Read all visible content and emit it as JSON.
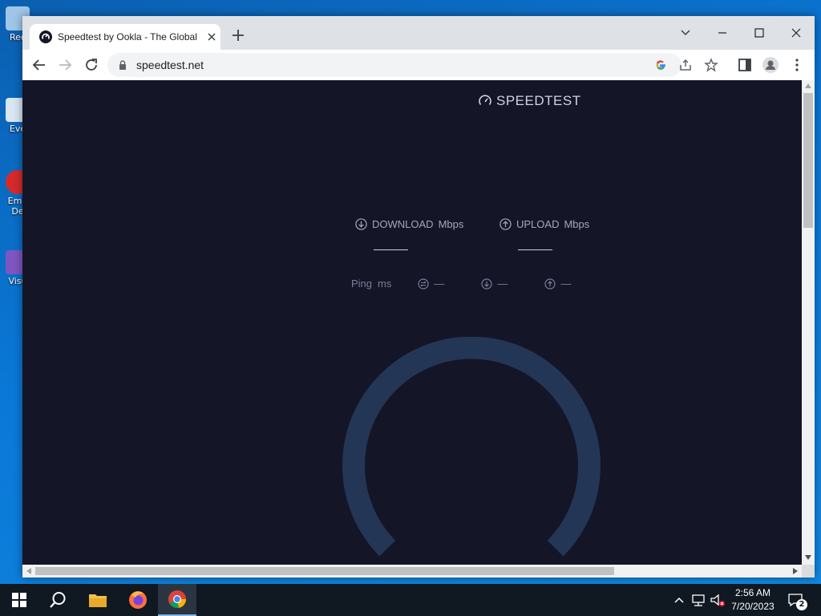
{
  "desktop": {
    "icons": [
      {
        "label": "Rec"
      },
      {
        "label": "Eve"
      },
      {
        "label": "Emb De"
      },
      {
        "label": "Visu"
      }
    ]
  },
  "browser": {
    "tab": {
      "title": "Speedtest by Ookla - The Global Broadband Speed Test"
    },
    "url": "speedtest.net"
  },
  "speedtest": {
    "logo_text": "SPEEDTEST",
    "download_label": "DOWNLOAD",
    "upload_label": "UPLOAD",
    "unit": "Mbps",
    "ping_label": "Ping",
    "ping_unit": "ms",
    "jitter_value": "—",
    "ping_download_value": "—",
    "ping_upload_value": "—"
  },
  "taskbar": {
    "time": "2:56 AM",
    "date": "7/20/2023",
    "notification_count": "2"
  },
  "colors": {
    "page_bg": "#141526",
    "gauge": "#233656",
    "accent_text": "#a4a8be"
  }
}
